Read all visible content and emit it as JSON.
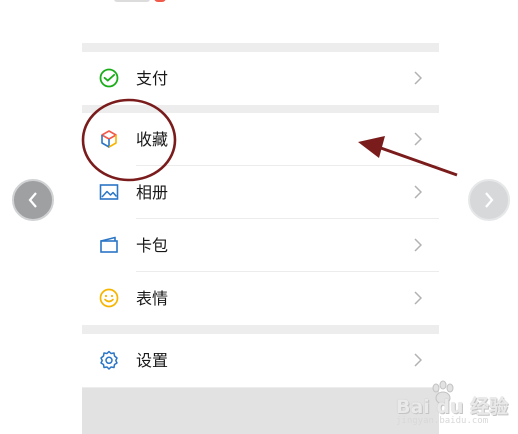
{
  "menu": {
    "items": [
      {
        "key": "pay",
        "label": "支付",
        "icon": "pay-check-icon"
      },
      {
        "key": "favorites",
        "label": "收藏",
        "icon": "cube-icon"
      },
      {
        "key": "album",
        "label": "相册",
        "icon": "image-icon"
      },
      {
        "key": "cards",
        "label": "卡包",
        "icon": "wallet-card-icon"
      },
      {
        "key": "stickers",
        "label": "表情",
        "icon": "smiley-icon"
      },
      {
        "key": "settings",
        "label": "设置",
        "icon": "gear-icon"
      }
    ]
  },
  "navigation": {
    "prev_icon": "chevron-left-icon",
    "next_icon": "chevron-right-icon"
  },
  "annotation": {
    "highlight_color": "#7b1c1c",
    "target": "favorites"
  },
  "watermark": {
    "text": "Bai du 经验",
    "subtext": "jingyan.baidu.com"
  },
  "colors": {
    "pay": "#1aad19",
    "settings": "#2b76c6",
    "stickers": "#f7b500",
    "background": "#ededed"
  }
}
